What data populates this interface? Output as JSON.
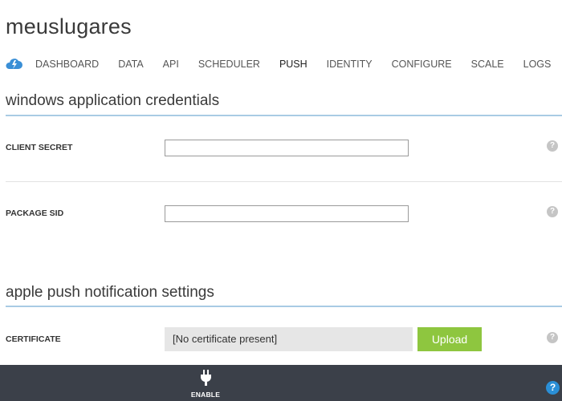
{
  "app": {
    "title": "meuslugares"
  },
  "nav": {
    "tabs": [
      {
        "label": "DASHBOARD"
      },
      {
        "label": "DATA"
      },
      {
        "label": "API"
      },
      {
        "label": "SCHEDULER"
      },
      {
        "label": "PUSH"
      },
      {
        "label": "IDENTITY"
      },
      {
        "label": "CONFIGURE"
      },
      {
        "label": "SCALE"
      },
      {
        "label": "LOGS"
      }
    ],
    "active_tab": "PUSH"
  },
  "windows": {
    "title": "windows application credentials",
    "client_secret": {
      "label": "CLIENT SECRET",
      "value": ""
    },
    "package_sid": {
      "label": "PACKAGE SID",
      "value": ""
    }
  },
  "apple": {
    "title": "apple push notification settings",
    "certificate": {
      "label": "CERTIFICATE",
      "value": "[No certificate present]",
      "upload_label": "Upload"
    }
  },
  "toolbar": {
    "enable_label": "ENABLE",
    "help_glyph": "?"
  },
  "help": {
    "glyph": "?"
  },
  "colors": {
    "accent_rule": "#a9cbe4",
    "upload": "#8ec63f",
    "toolbar": "#3b4049",
    "help_blue": "#2a8fd6"
  }
}
